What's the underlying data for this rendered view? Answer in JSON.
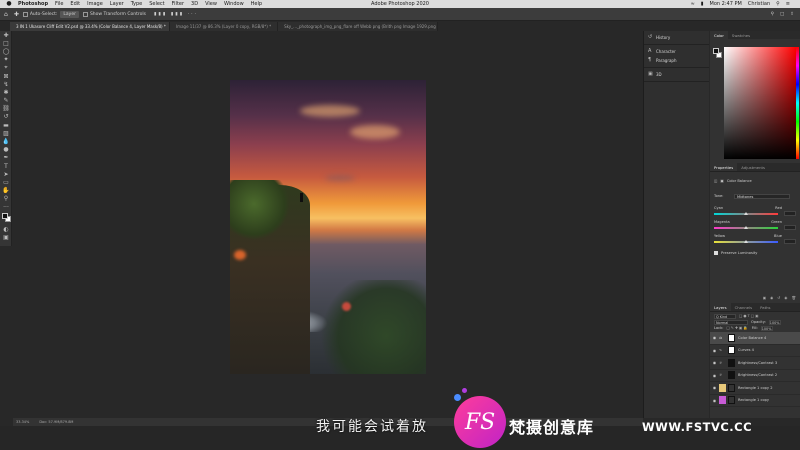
{
  "menubar": {
    "apple": "",
    "items": [
      "Photoshop",
      "File",
      "Edit",
      "Image",
      "Layer",
      "Type",
      "Select",
      "Filter",
      "3D",
      "View",
      "Window",
      "Help"
    ],
    "window_title": "Adobe Photoshop 2020",
    "clock": "Mon 2:47 PM",
    "user": "Christian"
  },
  "options_bar": {
    "auto_select": "Auto-Select:",
    "auto_select_target": "Layer",
    "show_transform": "Show Transform Controls"
  },
  "tabs": [
    "3 IN 1 Ukasore Cliff Edit V2.psd @ 33.4% (Color Balance 4, Layer Mask/8) *",
    "Image 11/37 @ 86.3% (Layer 0 copy, RGB/8*) *",
    "Sky_..._photograph_img_png_flare off Webb png (Brith png Image 1929.png @ 66.1% (Layer 1 copy, Layer Mask/8) *"
  ],
  "statusbar": {
    "zoom": "33.34%",
    "doc": "Doc: 57.9M/879.8M"
  },
  "dock": {
    "group1": [
      "History"
    ],
    "group2": [
      "Character",
      "Paragraph"
    ],
    "group3": [
      "3D"
    ]
  },
  "color_panel": {
    "tabs": [
      "Color",
      "Swatches"
    ],
    "fg": "#111111",
    "hue": "#ff0000"
  },
  "properties": {
    "tabs": [
      "Properties",
      "Adjustments"
    ],
    "title": "Color Balance",
    "tone_label": "Tone:",
    "tone_value": "Midtones",
    "sliders": [
      {
        "left": "Cyan",
        "right": "Red",
        "value": 0
      },
      {
        "left": "Magenta",
        "right": "Green",
        "value": 0
      },
      {
        "left": "Yellow",
        "right": "Blue",
        "value": 0
      }
    ],
    "preserve": "Preserve Luminosity"
  },
  "layers_panel": {
    "tabs": [
      "Layers",
      "Channels",
      "Paths"
    ],
    "kind": "Q Kind",
    "blend": "Normal",
    "opacity_label": "Opacity:",
    "opacity": "100%",
    "lock_label": "Lock:",
    "fill_label": "Fill:",
    "fill": "100%",
    "layers": [
      {
        "name": "Color Balance 4",
        "thumb": "#d0d0d0",
        "selected": true
      },
      {
        "name": "Curves 4",
        "thumb": "#cfcfcf",
        "selected": false
      },
      {
        "name": "Brightness/Contrast 3",
        "thumb": "#222222",
        "selected": false
      },
      {
        "name": "Brightness/Contrast 2",
        "thumb": "#222222",
        "selected": false
      },
      {
        "name": "Rectangle 1 copy 2",
        "thumb": "#e8c97a",
        "selected": false
      },
      {
        "name": "Rectangle 1 copy",
        "thumb": "#c85bd6",
        "selected": false
      }
    ]
  },
  "overlay": {
    "subtitle": "我可能会试着放",
    "logo_text": "FS",
    "brand": "梵摄创意库",
    "site": "WWW.FSTVC.CC",
    "accent": "#e83a9e"
  }
}
